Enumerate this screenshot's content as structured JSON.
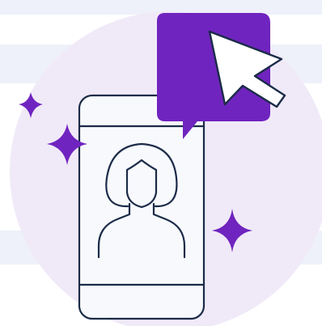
{
  "illustration": {
    "icons": {
      "background": "circle-backdrop-icon",
      "stripes": "horizontal-stripes-icon",
      "phone": "smartphone-icon",
      "person": "person-avatar-icon",
      "speech": "speech-bubble-icon",
      "cursor": "mouse-pointer-icon",
      "sparkle": "sparkle-icon"
    },
    "colors": {
      "stripe": "#eef1f9",
      "circle": "#f0eaf8",
      "phone_fill": "#f7f9fd",
      "outline": "#1b2b48",
      "purple": "#7024bf",
      "cursor_fill": "#ffffff"
    }
  }
}
